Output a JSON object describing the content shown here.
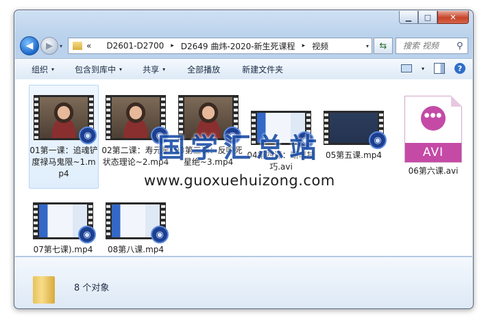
{
  "window": {
    "minimize": "▁",
    "maximize": "□",
    "close": "✕"
  },
  "nav": {
    "back": "◀",
    "forward": "▶",
    "dropdown": "▾"
  },
  "address": {
    "overflow": "«",
    "crumbs": [
      "D2601-D2700",
      "D2649 曲炜-2020-新生死课程",
      "视频"
    ],
    "separator": "▸"
  },
  "search": {
    "placeholder": "搜索 视频"
  },
  "toolbar": {
    "organize": "组织",
    "include_in_library": "包含到库中",
    "share": "共享",
    "play_all": "全部播放",
    "new_folder": "新建文件夹",
    "caret": "▾"
  },
  "files": [
    {
      "name": "01第一课：追魂铲度禄马鬼限~1.mp4",
      "kind": "video-person",
      "selected": true
    },
    {
      "name": "02第二课：寿元星状态理论~2.mp4",
      "kind": "video-person"
    },
    {
      "name": "03第三课：反吟死星绝~3.mp4",
      "kind": "video-person"
    },
    {
      "name": "04第四课：断事技巧.avi",
      "kind": "video-screen"
    },
    {
      "name": "05第五课.mp4",
      "kind": "video-dark"
    },
    {
      "name": "06第六课.avi",
      "kind": "avi-icon",
      "icon_text": "AVI"
    },
    {
      "name": "07第七课).mp4",
      "kind": "video-screen"
    },
    {
      "name": "08第八课.mp4",
      "kind": "video-screen"
    }
  ],
  "watermark": {
    "cn": "国学汇总站",
    "url": "www.guoxuehuizong.com"
  },
  "status": {
    "count": "8 个对象"
  },
  "colors": {
    "accent": "#1c4fa8",
    "avi": "#c44aa6"
  }
}
